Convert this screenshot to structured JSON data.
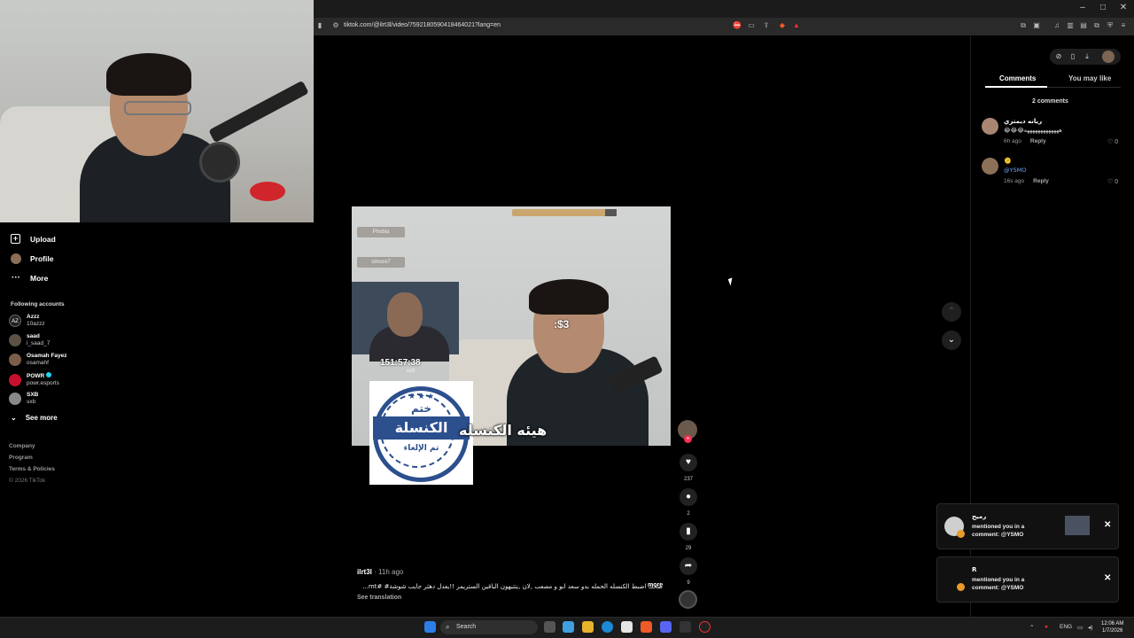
{
  "browser": {
    "url": "tiktok.com/@ilrt3l/video/7592180590418464021?lang=en",
    "window_controls": [
      "–",
      "□",
      "✕"
    ]
  },
  "sidebar": {
    "nav": [
      {
        "label": "Upload",
        "icon": "upload-icon"
      },
      {
        "label": "Profile",
        "icon": "profile-avatar"
      },
      {
        "label": "More",
        "icon": "more-dots-icon"
      }
    ],
    "following_title": "Following accounts",
    "accounts": [
      {
        "name": "Azzz",
        "handle": "10azzz"
      },
      {
        "name": "saad",
        "handle": "i_saad_7"
      },
      {
        "name": "Osamah Fayez",
        "handle": "osamahf"
      },
      {
        "name": "POWR",
        "handle": "powr.esports",
        "verified": true
      },
      {
        "name": "SXB",
        "handle": "sxb"
      }
    ],
    "see_more": "See more",
    "footer": [
      "Company",
      "Program",
      "Terms & Policies",
      "© 2026 TikTok"
    ]
  },
  "video": {
    "tags": [
      "Phobia",
      "slmore7"
    ],
    "timer": "151:57:38",
    "timer_sub": "ilrt3l",
    "money_overlay": ":$3",
    "caption": "هيئه الكنسله",
    "stamp": {
      "stars": "★ ★ ★",
      "line1": "ختم",
      "line2": "الكنسلة",
      "line3": "تم الإلغاء"
    }
  },
  "actions": {
    "likes": "237",
    "comments": "2",
    "saves": "29",
    "shares": "9"
  },
  "info": {
    "author": "ilrt3l",
    "time": " · 11h ago",
    "description": "ضحك اضبط الكنسله الحمله بدو سعد ابو و مصعب ,لان ,يتتبهون الباقين الستريمر !!يعدل دهثر جايب شوشة# #mt...",
    "more": "more",
    "see_translation": "See translation"
  },
  "right_panel": {
    "tabs": [
      "Comments",
      "You may like"
    ],
    "comments_count": "2 comments",
    "comments": [
      {
        "name": "ريانه ديمتري",
        "text": "😂😂😂هههههههههههههه",
        "time": "6h ago",
        "reply": "Reply",
        "likes": "0"
      },
      {
        "name": "",
        "mention_line": "🫠",
        "text": "@YSMO",
        "time": "16s ago",
        "reply": "Reply",
        "likes": "0"
      }
    ]
  },
  "notifications": [
    {
      "name": "رميح",
      "text": "mentioned you in a comment: @YSMO",
      "close": "✕"
    },
    {
      "name": "R",
      "text": "mentioned you in a comment: @YSMO",
      "close": "✕"
    }
  ],
  "taskbar": {
    "search": "Search",
    "lang": "ENG",
    "time": "12:06 AM",
    "date": "1/7/2026"
  }
}
